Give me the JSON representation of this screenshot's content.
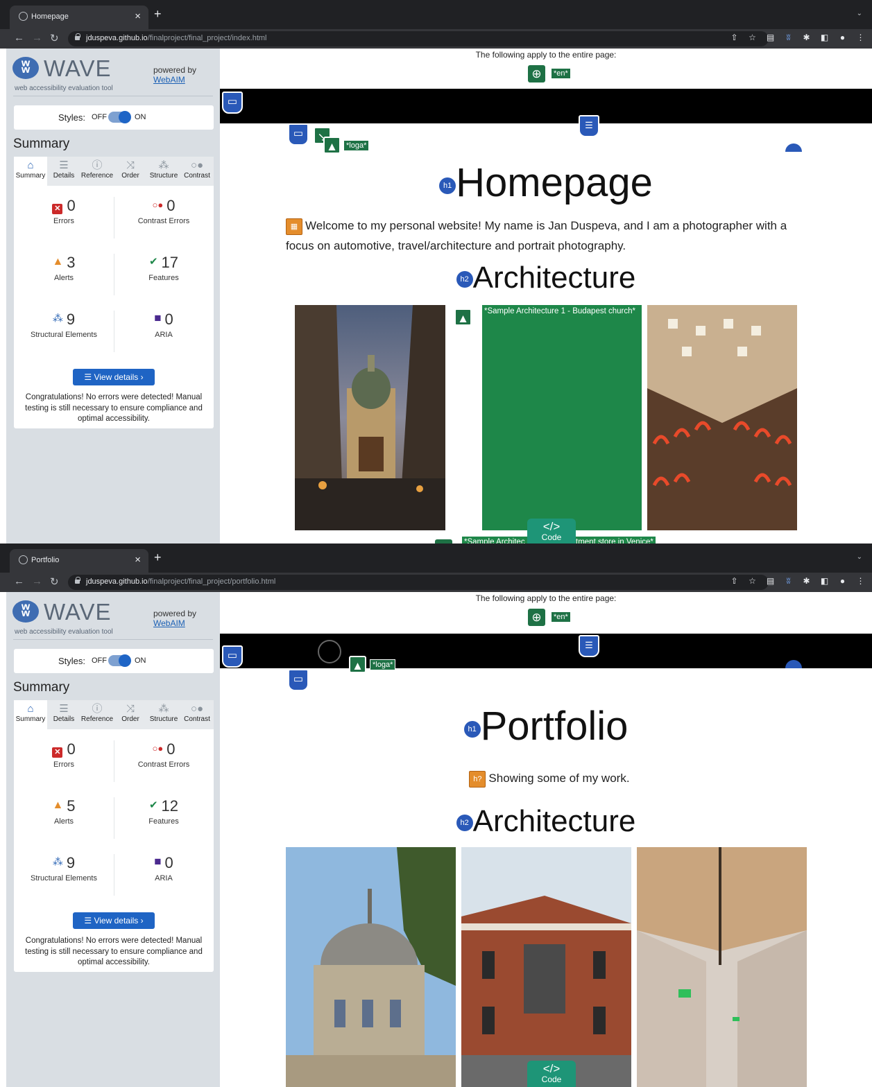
{
  "screens": [
    {
      "tab_title": "Homepage",
      "url_domain": "jduspeva.github.io",
      "url_path": "/finalproject/final_project/index.html",
      "wave": {
        "title": "WAVE",
        "subtitle": "web accessibility evaluation tool",
        "powered_by": "powered by",
        "webaim": "WebAIM",
        "styles_label": "Styles:",
        "styles_off": "OFF",
        "styles_on": "ON",
        "summary_heading": "Summary",
        "tabs": [
          "Summary",
          "Details",
          "Reference",
          "Order",
          "Structure",
          "Contrast"
        ],
        "errors": "0",
        "errors_label": "Errors",
        "contrast": "0",
        "contrast_label": "Contrast Errors",
        "alerts": "3",
        "alerts_label": "Alerts",
        "features": "17",
        "features_label": "Features",
        "structural": "9",
        "structural_label": "Structural Elements",
        "aria": "0",
        "aria_label": "ARIA",
        "view_details": "View details ›",
        "congrats": "Congratulations! No errors were detected! Manual testing is still necessary to ensure compliance and optimal accessibility."
      },
      "page": {
        "applies": "The following apply to the entire page:",
        "lang_tag": "*en*",
        "logo_tag": "*loga*",
        "h1": "Homepage",
        "intro": "Welcome to my personal website! My name is Jan Duspeva, and I am a photographer with a focus on automotive, travel/architecture and portrait photography.",
        "h2": "Architecture",
        "alt1": "*Sample Architecture 1 - Budapest church*",
        "alt2": "*Sample Architec",
        "alt2b": "tment store in Venice*",
        "code": "Code"
      }
    },
    {
      "tab_title": "Portfolio",
      "url_domain": "jduspeva.github.io",
      "url_path": "/finalproject/final_project/portfolio.html",
      "wave": {
        "title": "WAVE",
        "subtitle": "web accessibility evaluation tool",
        "powered_by": "powered by",
        "webaim": "WebAIM",
        "styles_label": "Styles:",
        "styles_off": "OFF",
        "styles_on": "ON",
        "summary_heading": "Summary",
        "tabs": [
          "Summary",
          "Details",
          "Reference",
          "Order",
          "Structure",
          "Contrast"
        ],
        "errors": "0",
        "errors_label": "Errors",
        "contrast": "0",
        "contrast_label": "Contrast Errors",
        "alerts": "5",
        "alerts_label": "Alerts",
        "features": "12",
        "features_label": "Features",
        "structural": "9",
        "structural_label": "Structural Elements",
        "aria": "0",
        "aria_label": "ARIA",
        "view_details": "View details ›",
        "congrats": "Congratulations! No errors were detected! Manual testing is still necessary to ensure compliance and optimal accessibility."
      },
      "page": {
        "applies": "The following apply to the entire page:",
        "lang_tag": "*en*",
        "logo_tag": "*loga*",
        "h1": "Portfolio",
        "intro": "Showing some of my work.",
        "h2": "Architecture",
        "code": "Code"
      }
    }
  ]
}
